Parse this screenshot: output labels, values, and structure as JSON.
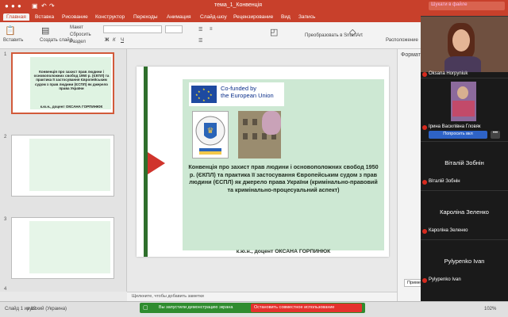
{
  "window": {
    "title": "тема_1_Конвенція",
    "search_hint": "Шукати в файле"
  },
  "ribbon_tabs": [
    "Главная",
    "Вставка",
    "Рисование",
    "Конструктор",
    "Переходы",
    "Анимация",
    "Слайд-шоу",
    "Рецензирование",
    "Вид",
    "Запись"
  ],
  "ribbon": {
    "paste": "Вставить",
    "new_slide": "Создать слайд",
    "layout": "Макет",
    "reset": "Сбросить",
    "section": "Раздел",
    "convert": "Преобразовать в SmartArt",
    "arrange": "Расположение"
  },
  "thumbnails": [
    {
      "num": "1",
      "text": "Конвенція про захист прав людини і основоположних свобод 1950 р. (ЄКПЛ) та практика її застосування Європейським судом з прав людини (ЄСПЛ) як джерело права України",
      "sub": "к.ю.н., доцент ОКСАНА ГОРПИНЮК"
    },
    {
      "num": "2",
      "text": ""
    },
    {
      "num": "3",
      "text": ""
    },
    {
      "num": "4",
      "text": ""
    }
  ],
  "slide": {
    "eu_line1": "Co-funded by",
    "eu_line2": "the European Union",
    "title": "Конвенція про захист прав людини і основоположних свобод 1950 р. (ЄКПЛ) та практика її застосування Європейським судом з прав людини (ЄСПЛ) як джерело права України (кримінально-правовий та кримінально-процесуальний аспект)",
    "author": "к.ю.н., доцент ОКСАНА ГОРПИНЮК"
  },
  "notes_placeholder": "Щелкните, чтобы добавить заметки",
  "share_bar": {
    "message": "Вы запустили демонстрацию экрана",
    "stop": "Остановить совместное использование"
  },
  "format_panel": {
    "title": "Формат",
    "apply_all": "Применить ко всем"
  },
  "status": {
    "slide_info": "Слайд 1 из 10",
    "language": "русский (Украина)",
    "zoom": "102%"
  },
  "participants": [
    {
      "name": "Oksana Horpyniuk"
    },
    {
      "name": "Ірина Василівна Гловяк",
      "button": "Попросить вкл"
    },
    {
      "name": "Віталій Зобнін"
    },
    {
      "name": "Кароліна Зеленко"
    },
    {
      "name": "Pylypenko Ivan"
    }
  ]
}
